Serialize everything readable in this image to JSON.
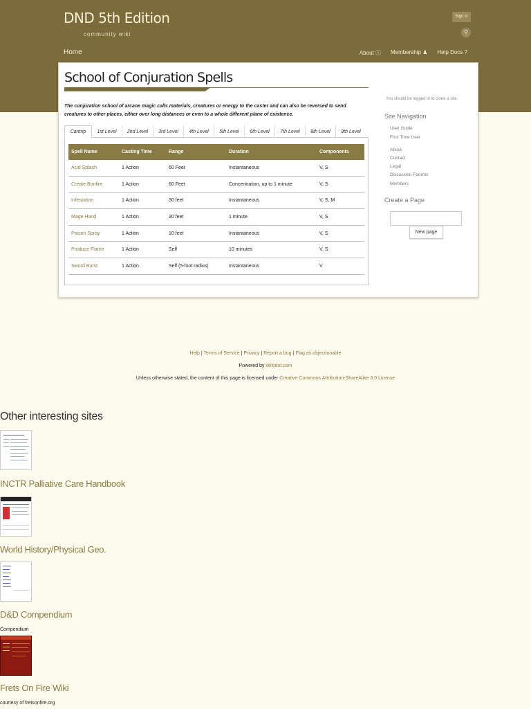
{
  "header": {
    "site_title": "DND 5th Edition",
    "site_subtitle": "community wiki",
    "sign_in": "Sign in",
    "search_icon": "magnifier-icon",
    "nav_home": "Home",
    "nav_items": [
      {
        "label": "About",
        "icon": "info-circle-icon",
        "glyph": "ⓘ"
      },
      {
        "label": "Membership",
        "icon": "user-icon",
        "glyph": "♟"
      },
      {
        "label": "Help Docs",
        "icon": "question-circle-icon",
        "glyph": "?"
      }
    ]
  },
  "main": {
    "page_title": "School of Conjuration Spells",
    "intro": "The conjuration school of arcane magic calls materials, creatures or energy to the caster and can also be reversed to send creatures to other places, either over long distances or even to a whole different plane of existence.",
    "tabs": [
      "Cantrip",
      "1st Level",
      "2nd Level",
      "3rd Level",
      "4th Level",
      "5th Level",
      "6th Level",
      "7th Level",
      "8th Level",
      "9th Level"
    ],
    "active_tab": "Cantrip",
    "table_headers": [
      "Spell Name",
      "Casting Time",
      "Range",
      "Duration",
      "Components"
    ],
    "rows": [
      [
        "Acid Splash",
        "1 Action",
        "60 Feet",
        "Instantaneous",
        "V, S"
      ],
      [
        "Create Bonfire",
        "1 Action",
        "60 Feet",
        "Concentration, up to 1 minute",
        "V, S"
      ],
      [
        "Infestation",
        "1 Action",
        "30 feet",
        "Instantaneous",
        "V, S, M"
      ],
      [
        "Mage Hand",
        "1 Action",
        "30 feet",
        "1 minute",
        "V, S"
      ],
      [
        "Poison Spray",
        "1 Action",
        "10 feet",
        "Instantaneous",
        "V, S"
      ],
      [
        "Produce Flame",
        "1 Action",
        "Self",
        "10 minutes",
        "V, S"
      ],
      [
        "Sword Burst",
        "1 Action",
        "Self (5-foot radius)",
        "Instantaneous",
        "V"
      ]
    ]
  },
  "sidebar": {
    "login_note": "You should be logged in to clone a site.",
    "nav_heading": "Site Navigation",
    "nav_group1": [
      "User Guide",
      "First Time User"
    ],
    "nav_group2": [
      "About",
      "Contact",
      "Legal",
      "Discussion Forums",
      "Members"
    ],
    "create_heading": "Create a Page",
    "new_page_button": "New page"
  },
  "footer": {
    "links": [
      "Help",
      "Terms of Service",
      "Privacy",
      "Report a bug",
      "Flag as objectionable"
    ],
    "powered_prefix": "Powered by",
    "powered_link": "Wikidot.com",
    "license_prefix": "Unless otherwise stated, the content of this page is licensed under",
    "license_link": "Creative Commons Attribution-ShareAlike 3.0 License"
  },
  "other_sites": {
    "heading": "Other interesting sites",
    "sites": [
      {
        "name": "INCTR Palliative Care Handbook",
        "description": ""
      },
      {
        "name": "World History/Physical Geo.",
        "description": ""
      },
      {
        "name": "D&D Compendium",
        "description": "Compendium"
      },
      {
        "name": "Frets On Fire Wiki",
        "description": "courtesy of fretsonfire.org"
      }
    ]
  }
}
